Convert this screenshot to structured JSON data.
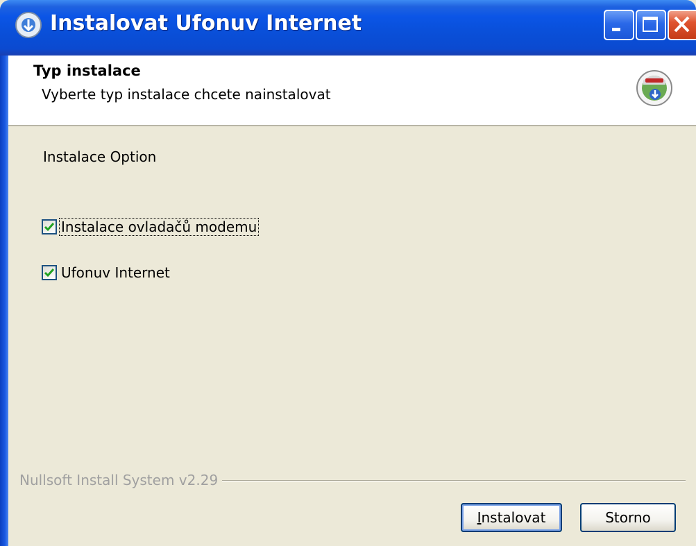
{
  "window": {
    "title": "Instalovat Ufonuv Internet"
  },
  "header": {
    "title": "Typ instalace",
    "subtitle": "Vyberte typ instalace chcete nainstalovat"
  },
  "content": {
    "option_label": "Instalace Option",
    "checkboxes": [
      {
        "label": "Instalace ovladačů modemu",
        "checked": true
      },
      {
        "label": "Ufonuv Internet",
        "checked": true
      }
    ]
  },
  "footer": {
    "branding": "Nullsoft Install System v2.29",
    "install_label_first": "I",
    "install_label_rest": "nstalovat",
    "cancel_label": "Storno"
  },
  "colors": {
    "titlebar": "#0b55e6",
    "face": "#ece9d8",
    "check": "#21a121"
  },
  "icons": {
    "app": "installer-icon",
    "header": "nsis-install-icon",
    "minimize": "minimize-icon",
    "maximize": "maximize-icon",
    "close": "close-icon"
  }
}
